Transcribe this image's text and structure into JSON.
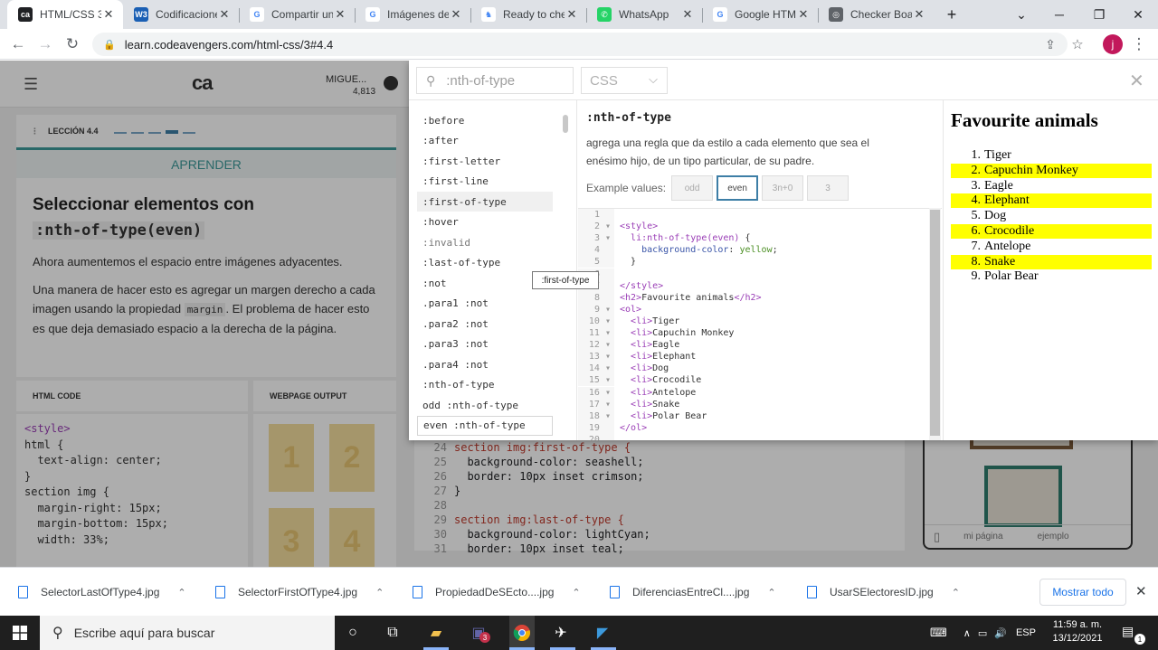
{
  "browser": {
    "tabs": [
      {
        "title": "HTML/CSS 3.4",
        "favicon_color": "#202124",
        "favicon_text": "ca",
        "active": true
      },
      {
        "title": "Codificacione",
        "favicon_color": "#1a5fb4",
        "favicon_text": "W3"
      },
      {
        "title": "Compartir un",
        "favicon_color": "#ffffff",
        "favicon_text": "G"
      },
      {
        "title": "Imágenes de",
        "favicon_color": "#ffffff",
        "favicon_text": "G"
      },
      {
        "title": "Ready to che",
        "favicon_color": "#ffffff",
        "favicon_text": "♞"
      },
      {
        "title": "WhatsApp",
        "favicon_color": "#25d366",
        "favicon_text": "✆"
      },
      {
        "title": "Google HTML",
        "favicon_color": "#ffffff",
        "favicon_text": "G"
      },
      {
        "title": "Checker Boar",
        "favicon_color": "#5f6368",
        "favicon_text": "◎"
      }
    ],
    "new_tab": "+",
    "url": "learn.codeavengers.com/html-css/3#4.4",
    "profile_initial": "j",
    "window_controls": [
      "⌄",
      "─",
      "❐",
      "✕"
    ]
  },
  "codeavengers": {
    "logo": "ca",
    "user_name": "MIGUE...",
    "user_points": "4,813",
    "lesson_label": "LECCIÓN 4.4",
    "section_label": "APRENDER",
    "title_prefix": "Seleccionar elementos con",
    "title_code": ":nth-of-type(even)",
    "para1": "Ahora aumentemos el espacio entre imágenes adyacentes.",
    "para2_part1": "Una manera de hacer esto es agregar un margen derecho a cada imagen usando la propiedad ",
    "para2_code": "margin",
    "para2_part2": ". El problema de hacer esto es que deja demasiado espacio a la derecha de la página.",
    "html_code_label": "HTML CODE",
    "webpage_output_label": "WEBPAGE OUTPUT",
    "html_code_lines": [
      "<style>",
      "html {",
      "  text-align: center;",
      "}",
      "section img {",
      "  margin-right: 15px;",
      "  margin-bottom: 15px;",
      "  width: 33%;"
    ],
    "output_tiles": [
      "1",
      "2",
      "3",
      "4"
    ],
    "editor_lines": [
      {
        "num": "24",
        "text": "section img:first-of-type {"
      },
      {
        "num": "25",
        "text": "  background-color: seashell;"
      },
      {
        "num": "26",
        "text": "  border: 10px inset crimson;"
      },
      {
        "num": "27",
        "text": "}"
      },
      {
        "num": "28",
        "text": ""
      },
      {
        "num": "29",
        "text": "section img:last-of-type {"
      },
      {
        "num": "30",
        "text": "  background-color: lightCyan;"
      },
      {
        "num": "31",
        "text": "  border: 10px inset teal;"
      }
    ],
    "preview_tabs": [
      "mi página",
      "ejemplo"
    ]
  },
  "reference": {
    "search_value": ":nth-of-type",
    "language": "CSS",
    "selectors": [
      ":before",
      ":after",
      ":first-letter",
      ":first-line",
      ":first-of-type",
      ":hover",
      ":invalid",
      ":last-of-type",
      ":not",
      ".para1 :not",
      ".para2 :not",
      ".para3 :not",
      ".para4 :not",
      ":nth-of-type",
      "odd :nth-of-type",
      "even :nth-of-type"
    ],
    "hovered_index": 4,
    "current_index": 15,
    "tooltip": ":first-of-type",
    "detail_title": ":nth-of-type",
    "detail_desc": "agrega una regla que da estilo a cada elemento que sea el enésimo hijo, de un tipo particular, de su padre.",
    "example_label": "Example values:",
    "example_values": [
      "odd",
      "even",
      "3n+0",
      "3"
    ],
    "example_active": 1,
    "code_lines": [
      {
        "n": "1",
        "fold": "",
        "html": ""
      },
      {
        "n": "2",
        "fold": "▾",
        "html": "<span class='tag'>&lt;style&gt;</span>"
      },
      {
        "n": "3",
        "fold": "▾",
        "html": "  <span class='sel'>li:nth-of-type(even)</span> {"
      },
      {
        "n": "4",
        "fold": "",
        "html": "    <span class='prop'>background-color</span>: <span class='val'>yellow</span>;"
      },
      {
        "n": "5",
        "fold": "",
        "html": "  }"
      },
      {
        "n": "6",
        "fold": "",
        "html": ""
      },
      {
        "n": "7",
        "fold": "",
        "html": "<span class='tag'>&lt;/style&gt;</span>"
      },
      {
        "n": "8",
        "fold": "",
        "html": "<span class='tag'>&lt;h2&gt;</span>Favourite animals<span class='tag'>&lt;/h2&gt;</span>"
      },
      {
        "n": "9",
        "fold": "▾",
        "html": "<span class='tag'>&lt;ol&gt;</span>"
      },
      {
        "n": "10",
        "fold": "▾",
        "html": "  <span class='tag'>&lt;li&gt;</span>Tiger"
      },
      {
        "n": "11",
        "fold": "▾",
        "html": "  <span class='tag'>&lt;li&gt;</span>Capuchin Monkey"
      },
      {
        "n": "12",
        "fold": "▾",
        "html": "  <span class='tag'>&lt;li&gt;</span>Eagle"
      },
      {
        "n": "13",
        "fold": "▾",
        "html": "  <span class='tag'>&lt;li&gt;</span>Elephant"
      },
      {
        "n": "14",
        "fold": "▾",
        "html": "  <span class='tag'>&lt;li&gt;</span>Dog"
      },
      {
        "n": "15",
        "fold": "▾",
        "html": "  <span class='tag'>&lt;li&gt;</span>Crocodile"
      },
      {
        "n": "16",
        "fold": "▾",
        "html": "  <span class='tag'>&lt;li&gt;</span>Antelope"
      },
      {
        "n": "17",
        "fold": "▾",
        "html": "  <span class='tag'>&lt;li&gt;</span>Snake"
      },
      {
        "n": "18",
        "fold": "▾",
        "html": "  <span class='tag'>&lt;li&gt;</span>Polar Bear"
      },
      {
        "n": "19",
        "fold": "",
        "html": "<span class='tag'>&lt;/ol&gt;</span>"
      },
      {
        "n": "20",
        "fold": "",
        "html": ""
      }
    ],
    "output_heading": "Favourite animals",
    "output_items": [
      "Tiger",
      "Capuchin Monkey",
      "Eagle",
      "Elephant",
      "Dog",
      "Crocodile",
      "Antelope",
      "Snake",
      "Polar Bear"
    ],
    "highlight_color": "#ffff00"
  },
  "downloads": {
    "files": [
      "SelectorLastOfType4.jpg",
      "SelectorFirstOfType4.jpg",
      "PropiedadDeSEcto....jpg",
      "DiferenciasEntreCl....jpg",
      "UsarSElectoresID.jpg"
    ],
    "show_all": "Mostrar todo"
  },
  "taskbar": {
    "search_placeholder": "Escribe aquí para buscar",
    "teams_badge": "3",
    "language": "ESP",
    "time": "11:59 a. m.",
    "date": "13/12/2021",
    "notification_count": "1"
  }
}
